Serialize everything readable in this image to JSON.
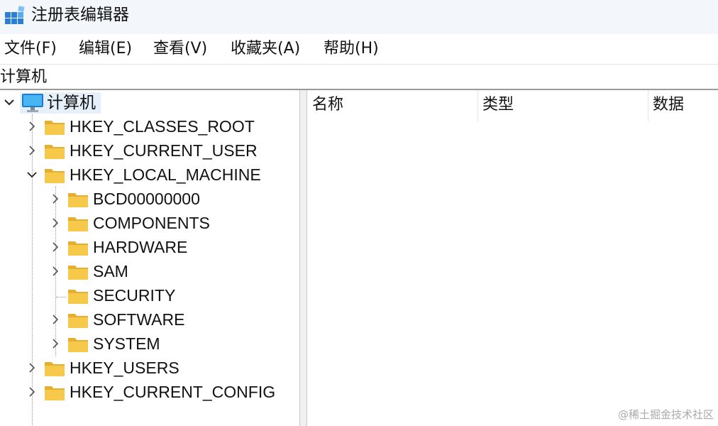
{
  "title_bar": {
    "title": "注册表编辑器",
    "icon": "registry-editor-icon"
  },
  "menu": {
    "items": [
      {
        "label": "文件(F)"
      },
      {
        "label": "编辑(E)"
      },
      {
        "label": "查看(V)"
      },
      {
        "label": "收藏夹(A)"
      },
      {
        "label": "帮助(H)"
      }
    ]
  },
  "address": {
    "path": "计算机"
  },
  "tree": {
    "root": {
      "label": "计算机",
      "icon": "computer-icon",
      "expanded": true,
      "selected": true
    },
    "hives": [
      {
        "label": "HKEY_CLASSES_ROOT",
        "expanded": false
      },
      {
        "label": "HKEY_CURRENT_USER",
        "expanded": false
      },
      {
        "label": "HKEY_LOCAL_MACHINE",
        "expanded": true,
        "children": [
          {
            "label": "BCD00000000",
            "has_children": true
          },
          {
            "label": "COMPONENTS",
            "has_children": true
          },
          {
            "label": "HARDWARE",
            "has_children": true
          },
          {
            "label": "SAM",
            "has_children": true
          },
          {
            "label": "SECURITY",
            "has_children": false
          },
          {
            "label": "SOFTWARE",
            "has_children": true
          },
          {
            "label": "SYSTEM",
            "has_children": true
          }
        ]
      },
      {
        "label": "HKEY_USERS",
        "expanded": false
      },
      {
        "label": "HKEY_CURRENT_CONFIG",
        "expanded": false
      }
    ]
  },
  "list": {
    "columns": [
      {
        "label": "名称"
      },
      {
        "label": "类型"
      },
      {
        "label": "数据"
      }
    ]
  },
  "watermark": "@稀土掘金技术社区",
  "colors": {
    "folder": "#f5c542",
    "selection": "#e5f0fb",
    "title_bar_bg": "#f3f6fb"
  }
}
